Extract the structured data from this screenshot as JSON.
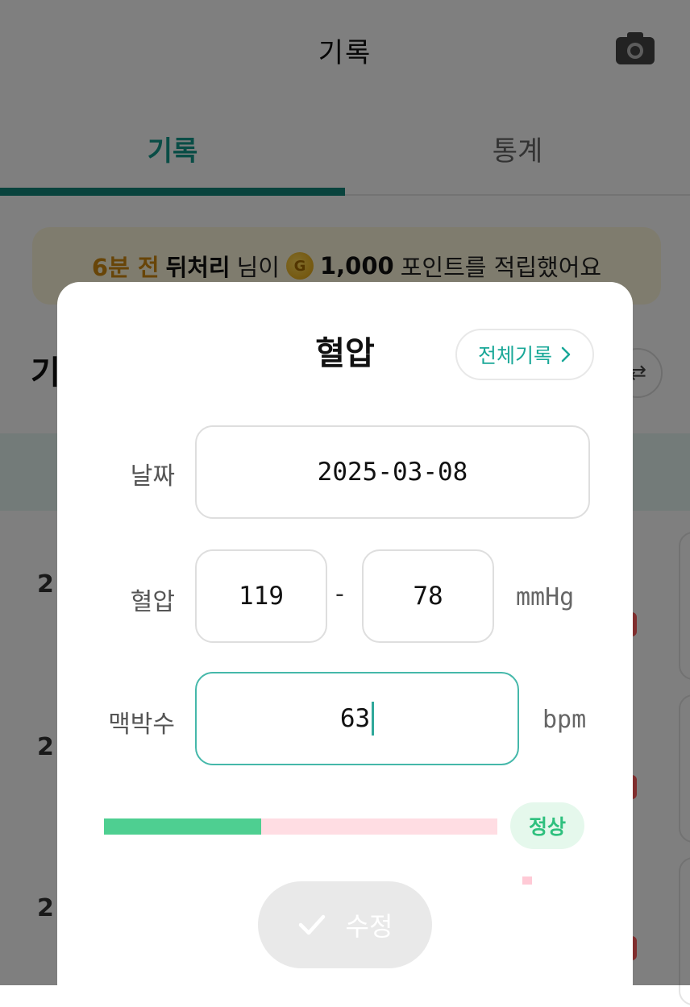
{
  "header": {
    "title": "기록",
    "camera_icon": "camera-icon"
  },
  "tabs": [
    {
      "label": "기록",
      "active": true
    },
    {
      "label": "통계",
      "active": false
    }
  ],
  "notice": {
    "time": "6분 전",
    "user": "뒤처리",
    "suffix": "님이",
    "coin_glyph": "G",
    "points": "1,000",
    "message": "포인트를 적립했어요"
  },
  "background": {
    "heading_partial": "기",
    "row_numbers": [
      "2",
      "2",
      "2"
    ]
  },
  "modal": {
    "title": "혈압",
    "all_records_label": "전체기록",
    "date": {
      "label": "날짜",
      "value": "2025-03-08"
    },
    "blood_pressure": {
      "label": "혈압",
      "systolic": "119",
      "separator": "-",
      "diastolic": "78",
      "unit": "mmHg"
    },
    "pulse": {
      "label": "맥박수",
      "value": "63",
      "unit": "bpm"
    },
    "status": {
      "label": "정상",
      "level_fraction": 0.4
    },
    "submit_label": "수정"
  },
  "colors": {
    "accent": "#12877b",
    "normal_green": "#4ecf91",
    "gauge_bg": "#ffdde3",
    "notice_time": "#d18a10"
  }
}
